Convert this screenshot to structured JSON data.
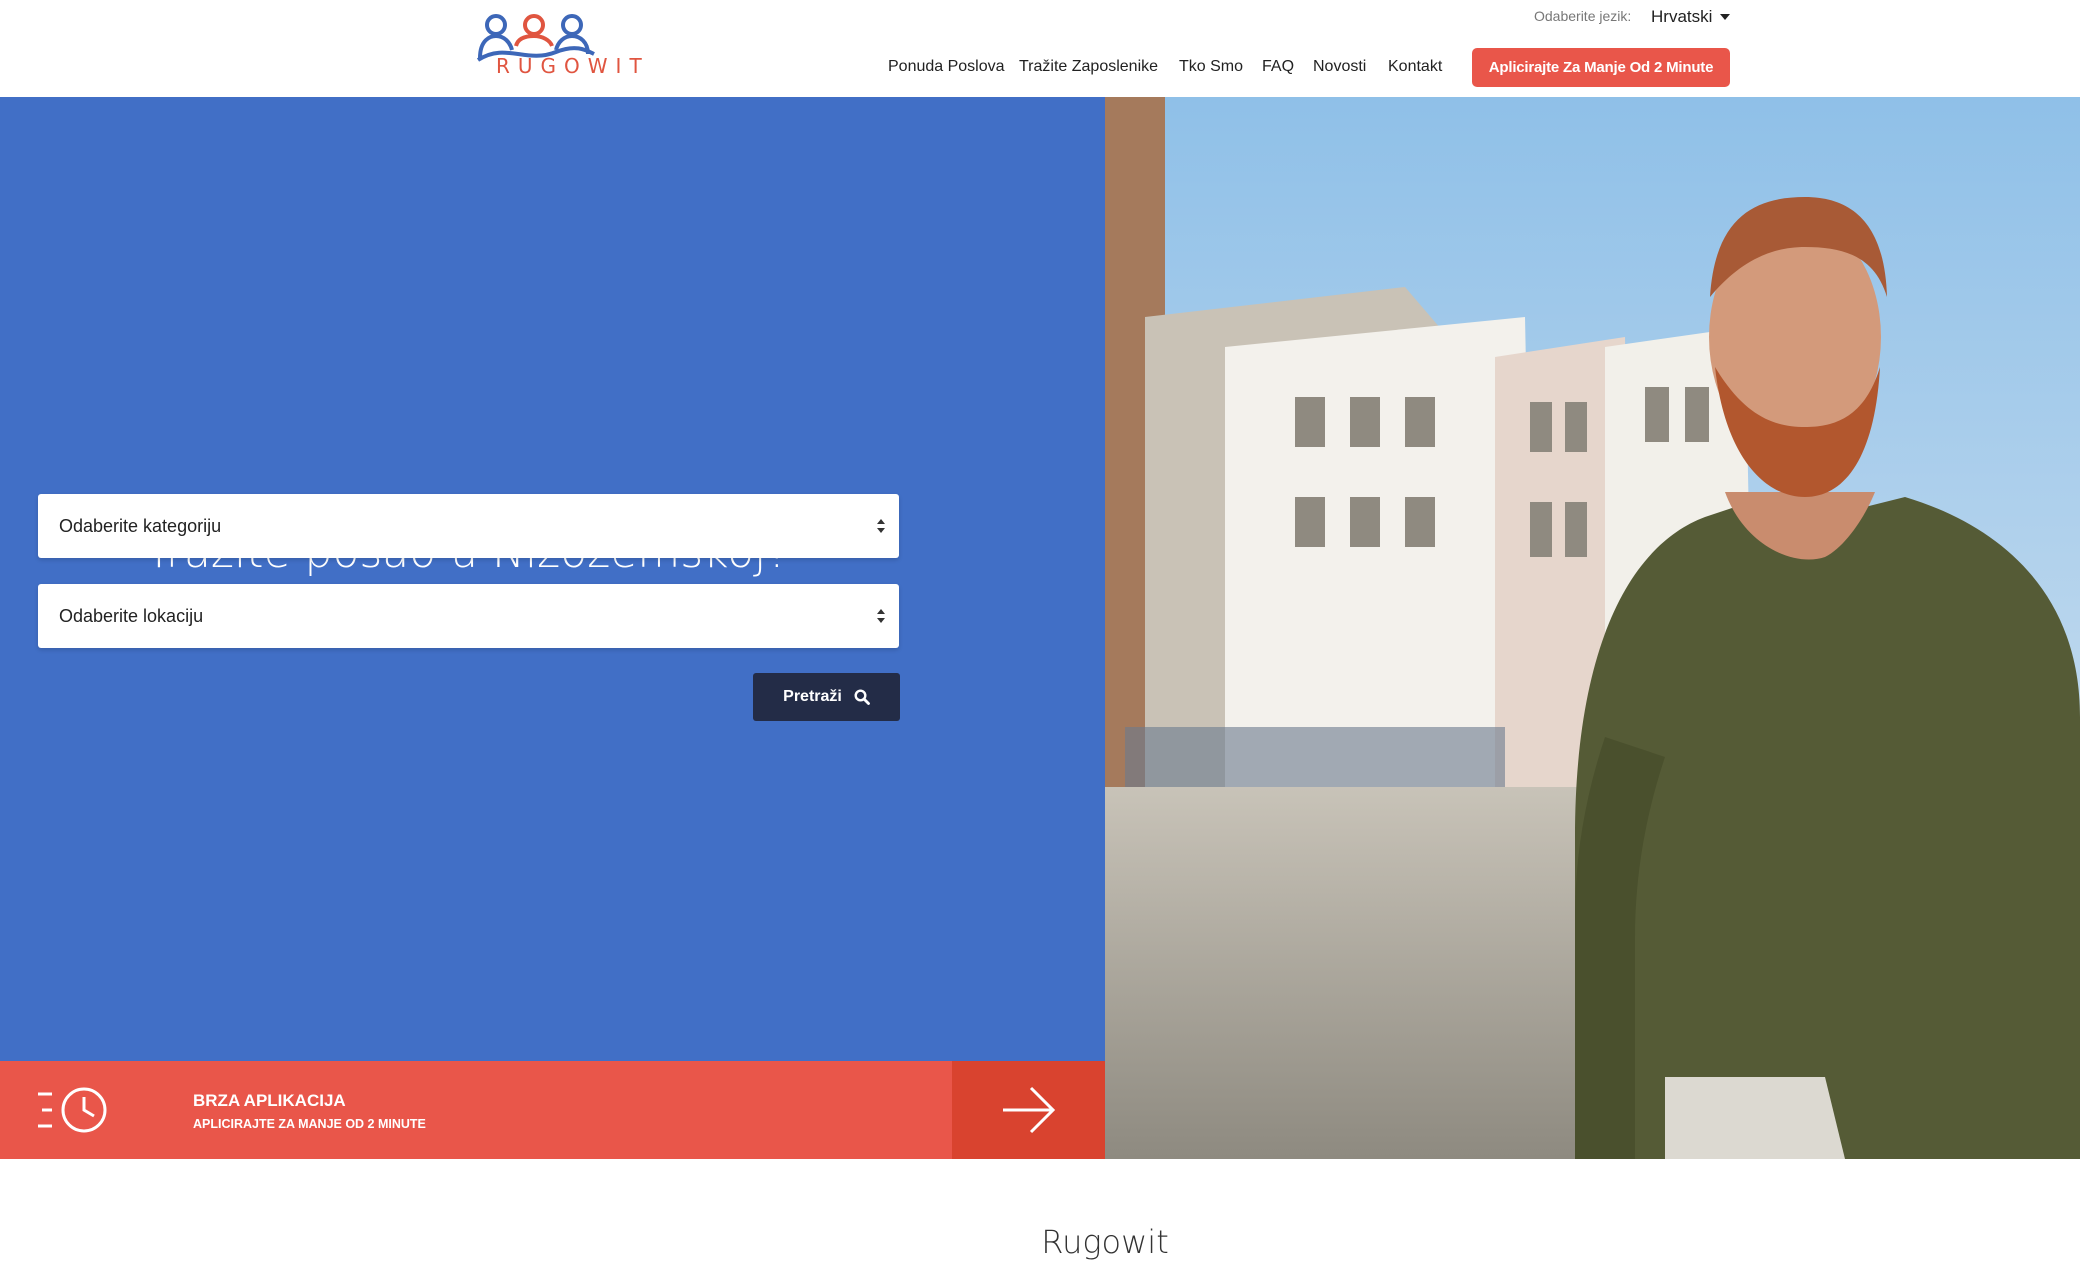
{
  "brand": {
    "name": "RUGOWIT",
    "colors": {
      "blue": "#416fc6",
      "red": "#e9564a",
      "dark": "#232c47"
    }
  },
  "language": {
    "label": "Odaberite jezik:",
    "selected": "Hrvatski"
  },
  "nav": {
    "items": [
      "Ponuda Poslova",
      "Tražite Zaposlenike",
      "Tko Smo",
      "FAQ",
      "Novosti",
      "Kontakt"
    ],
    "cta": "Aplicirajte Za Manje Od 2 Minute"
  },
  "hero": {
    "title": "Tražite posao u Nizozemskoj?",
    "category_select": "Odaberite kategoriju",
    "location_select": "Odaberite lokaciju",
    "search_button": "Pretraži",
    "search_icon": "search-icon"
  },
  "quick_apply": {
    "title": "BRZA APLIKACIJA",
    "subtitle": "APLICIRAJTE ZA MANJE OD 2 MINUTE",
    "icon": "fast-clock-icon",
    "arrow_icon": "arrow-right-icon"
  },
  "section": {
    "title": "Rugowit"
  }
}
